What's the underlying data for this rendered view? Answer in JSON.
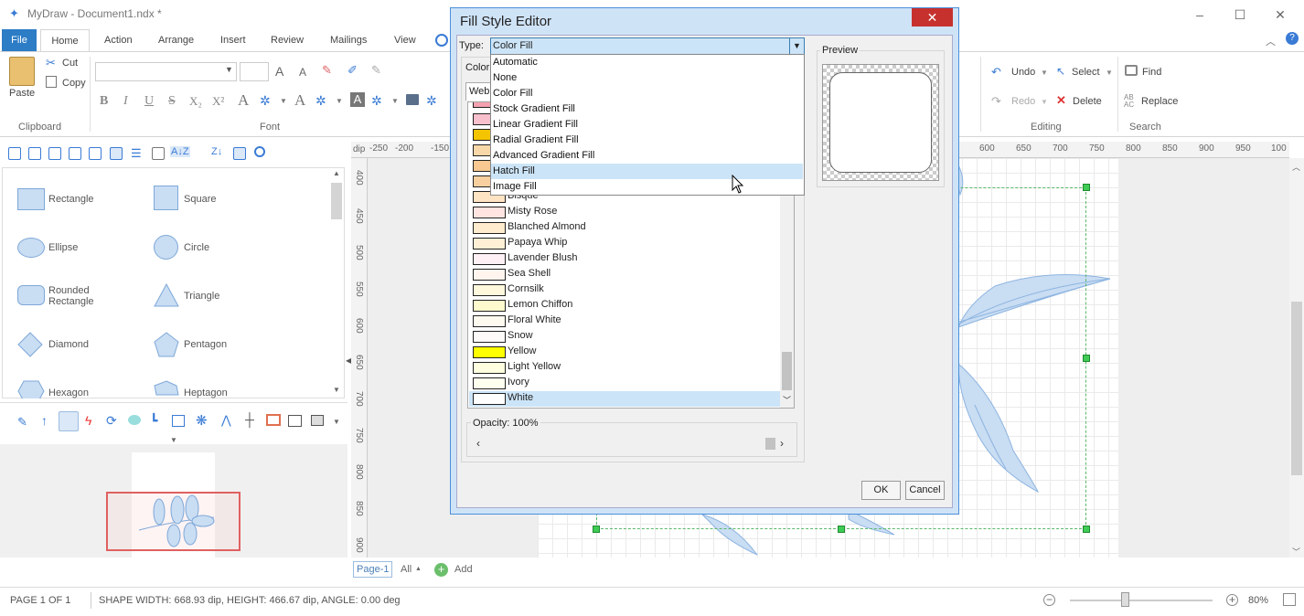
{
  "app": {
    "title": "MyDraw - Document1.ndx *"
  },
  "ribbon_tabs": [
    {
      "label": "File"
    },
    {
      "label": "Home"
    },
    {
      "label": "Action"
    },
    {
      "label": "Arrange"
    },
    {
      "label": "Insert"
    },
    {
      "label": "Review"
    },
    {
      "label": "Mailings"
    },
    {
      "label": "View"
    }
  ],
  "clipboard": {
    "paste": "Paste",
    "cut": "Cut",
    "copy": "Copy",
    "group": "Clipboard"
  },
  "font": {
    "group": "Font"
  },
  "editing": {
    "undo": "Undo",
    "redo": "Redo",
    "select": "Select",
    "delete": "Delete",
    "group": "Editing"
  },
  "search": {
    "find": "Find",
    "replace": "Replace",
    "group": "Search"
  },
  "shapes": [
    {
      "label": "Rectangle"
    },
    {
      "label": "Square"
    },
    {
      "label": "Ellipse"
    },
    {
      "label": "Circle"
    },
    {
      "label": "Rounded Rectangle"
    },
    {
      "label": "Triangle"
    },
    {
      "label": "Diamond"
    },
    {
      "label": "Pentagon"
    },
    {
      "label": "Hexagon"
    },
    {
      "label": "Heptagon"
    }
  ],
  "ruler": {
    "unit": "dip",
    "top_ticks": [
      "-250",
      "-200",
      "-150",
      "600",
      "650",
      "700",
      "750",
      "800",
      "850",
      "900",
      "950",
      "100"
    ],
    "left_ticks": [
      "400",
      "450",
      "500",
      "550",
      "600",
      "650",
      "700",
      "750",
      "800",
      "850",
      "900"
    ]
  },
  "pagebar": {
    "page": "Page-1",
    "all": "All",
    "add": "Add"
  },
  "status": {
    "page": "PAGE 1 OF 1",
    "shape_info": "SHAPE WIDTH: 668.93 dip, HEIGHT: 466.67 dip, ANGLE: 0.00 deg",
    "zoom": "80%"
  },
  "dialog": {
    "title": "Fill Style Editor",
    "type_label": "Type:",
    "type_value": "Color Fill",
    "color_label": "Color",
    "web_tab": "Web",
    "preview_label": "Preview",
    "opacity_label": "Opacity: 100%",
    "ok": "OK",
    "cancel": "Cancel",
    "dropdown_options": [
      "Automatic",
      "None",
      "Color Fill",
      "Stock Gradient Fill",
      "Linear Gradient Fill",
      "Radial Gradient Fill",
      "Advanced Gradient Fill",
      "Hatch Fill",
      "Image Fill"
    ],
    "dropdown_highlighted": "Hatch Fill",
    "colors": [
      {
        "name": "Bisque",
        "hex": "#FFE4C4"
      },
      {
        "name": "Misty Rose",
        "hex": "#FFE4E1"
      },
      {
        "name": "Blanched Almond",
        "hex": "#FFEBCD"
      },
      {
        "name": "Papaya Whip",
        "hex": "#FFEFD5"
      },
      {
        "name": "Lavender Blush",
        "hex": "#FFF0F5"
      },
      {
        "name": "Sea Shell",
        "hex": "#FFF5EE"
      },
      {
        "name": "Cornsilk",
        "hex": "#FFF8DC"
      },
      {
        "name": "Lemon Chiffon",
        "hex": "#FFFACD"
      },
      {
        "name": "Floral White",
        "hex": "#FFFAF0"
      },
      {
        "name": "Snow",
        "hex": "#FFFAFA"
      },
      {
        "name": "Yellow",
        "hex": "#FFFF00"
      },
      {
        "name": "Light Yellow",
        "hex": "#FFFFE0"
      },
      {
        "name": "Ivory",
        "hex": "#FFFFF0"
      },
      {
        "name": "White",
        "hex": "#FFFFFF"
      }
    ],
    "hidden_swatches": [
      "#F4A0B0",
      "#F8C0CC",
      "#F5C400",
      "#F8D8A8",
      "#F8C890",
      "#F8D0A0"
    ],
    "selected_color": "White"
  },
  "accent": "#2d7cc6"
}
